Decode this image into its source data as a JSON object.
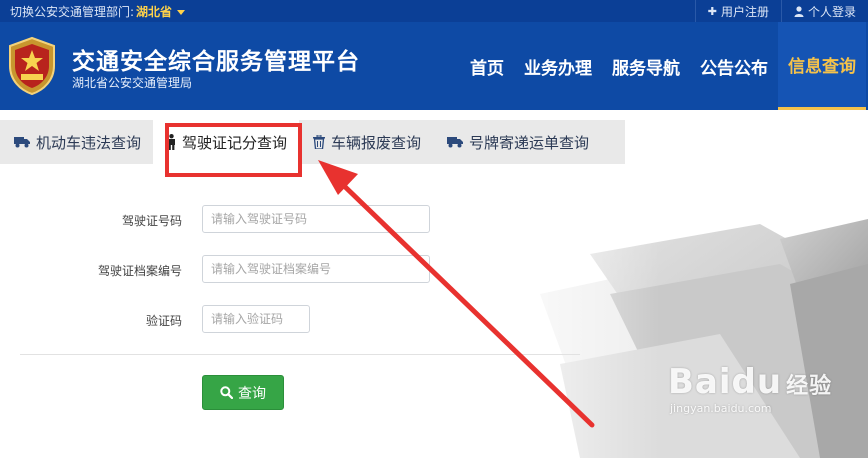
{
  "topbar": {
    "dept_label": "切换公安交通管理部门:",
    "dept_value": "湖北省",
    "register": "用户注册",
    "login": "个人登录"
  },
  "header": {
    "title": "交通安全综合服务管理平台",
    "subtitle": "湖北省公安交通管理局",
    "nav": [
      "首页",
      "业务办理",
      "服务导航",
      "公告公布",
      "信息查询"
    ],
    "active_nav": "信息查询"
  },
  "tabs": [
    {
      "label": "机动车违法查询",
      "icon": "truck-icon"
    },
    {
      "label": "驾驶证记分查询",
      "icon": "person-icon",
      "active": true
    },
    {
      "label": "车辆报废查询",
      "icon": "trash-icon"
    },
    {
      "label": "号牌寄递运单查询",
      "icon": "truck-icon"
    }
  ],
  "form": {
    "license_no_label": "驾驶证号码",
    "license_no_placeholder": "请输入驾驶证号码",
    "file_no_label": "驾驶证档案编号",
    "file_no_placeholder": "请输入驾驶证档案编号",
    "captcha_label": "验证码",
    "captcha_placeholder": "请输入验证码",
    "submit": "查询"
  },
  "watermark": {
    "brand_latin": "Baidu",
    "brand_cn": "经验",
    "url": "jingyan.baidu.com"
  },
  "colors": {
    "header_bg": "#0e4aa5",
    "topbar_bg": "#0b3f96",
    "accent_gold": "#f5c24a",
    "button_green": "#36a546",
    "annotation_red": "#e8322f"
  }
}
